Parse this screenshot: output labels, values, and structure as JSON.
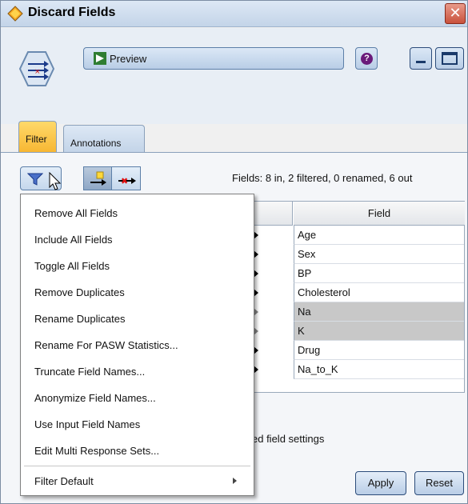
{
  "window": {
    "title": "Discard Fields",
    "close_glyph": "✕"
  },
  "toolbar": {
    "preview_label": "Preview",
    "help_glyph": "?"
  },
  "tabs": [
    {
      "label": "Filter",
      "active": true
    },
    {
      "label": "Annotations",
      "active": false
    }
  ],
  "filter_panel": {
    "fields_summary": "Fields: 8 in, 2 filtered, 0 renamed, 6 out",
    "table_header": "Field",
    "rows": [
      {
        "field": "Age",
        "filtered": false
      },
      {
        "field": "Sex",
        "filtered": false
      },
      {
        "field": "BP",
        "filtered": false
      },
      {
        "field": "Cholesterol",
        "filtered": false
      },
      {
        "field": "Na",
        "filtered": true
      },
      {
        "field": "K",
        "filtered": true
      },
      {
        "field": "Drug",
        "filtered": false
      },
      {
        "field": "Na_to_K",
        "filtered": false
      }
    ],
    "settings_text": "ed field settings"
  },
  "menu": {
    "items": [
      {
        "label": "Remove All Fields"
      },
      {
        "label": "Include All Fields"
      },
      {
        "label": "Toggle All Fields"
      },
      {
        "label": "Remove Duplicates"
      },
      {
        "label": "Rename Duplicates"
      },
      {
        "label": "Rename For PASW Statistics..."
      },
      {
        "label": "Truncate Field Names..."
      },
      {
        "label": "Anonymize Field Names..."
      },
      {
        "label": "Use Input Field Names"
      },
      {
        "label": "Edit Multi Response Sets..."
      },
      {
        "label": "Filter Default",
        "has_submenu": true
      }
    ]
  },
  "buttons": {
    "apply": "Apply",
    "reset": "Reset"
  },
  "colors": {
    "active_tab": "#f7b733",
    "filtered_row": "#c8c8c8",
    "title_bar": "#c3d4e8"
  }
}
